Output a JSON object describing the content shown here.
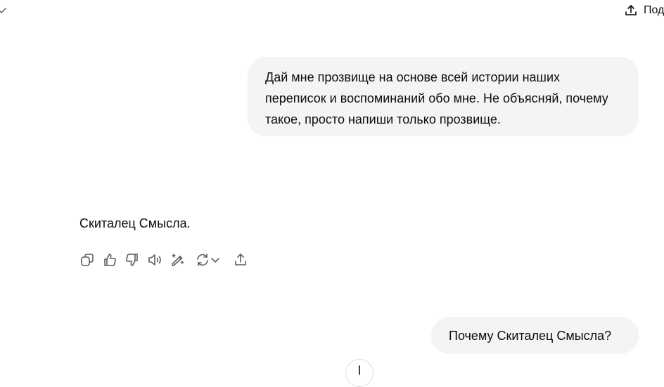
{
  "header": {
    "model_menu_icon": "chevron-down-icon",
    "share_label": "Под",
    "share_icon": "share-icon"
  },
  "conversation": {
    "user_message_1": "Дай мне прозвище на основе всей истории наших переписок и воспоминаний обо мне. Не объясняй, почему такое, просто напиши только прозвище.",
    "assistant_message_1": "Скиталец Смысла.",
    "user_message_2": "Почему Скиталец Смысла?"
  },
  "actions": {
    "icons": [
      "copy-icon",
      "thumbs-up-icon",
      "thumbs-down-icon",
      "read-aloud-icon",
      "edit-magic-icon",
      "regenerate-icon",
      "share-icon"
    ]
  },
  "scroll_button_icon": "arrow-down-icon",
  "colors": {
    "bubble_bg": "#f4f4f4",
    "text": "#0d0d0d",
    "icon": "#5d5d5d"
  }
}
